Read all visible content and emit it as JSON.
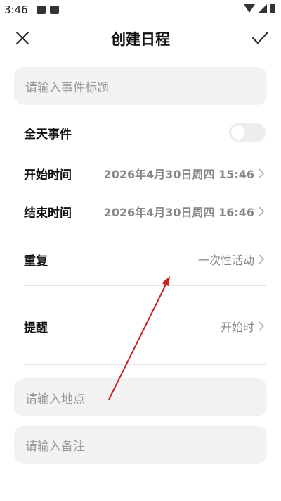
{
  "status": {
    "time": "3:46"
  },
  "header": {
    "title": "创建日程"
  },
  "event_title": {
    "placeholder": "请输入事件标题"
  },
  "all_day": {
    "label": "全天事件",
    "enabled": false
  },
  "start": {
    "label": "开始时间",
    "value": "2026年4月30日周四 15:46"
  },
  "end": {
    "label": "结束时间",
    "value": "2026年4月30日周四 16:46"
  },
  "repeat": {
    "label": "重复",
    "value": "一次性活动"
  },
  "reminder": {
    "label": "提醒",
    "value": "开始时"
  },
  "location": {
    "placeholder": "请输入地点"
  },
  "notes": {
    "placeholder": "请输入备注"
  },
  "colors": {
    "annotation_arrow": "#cc1f1f",
    "field_bg": "#f2f2f2"
  }
}
